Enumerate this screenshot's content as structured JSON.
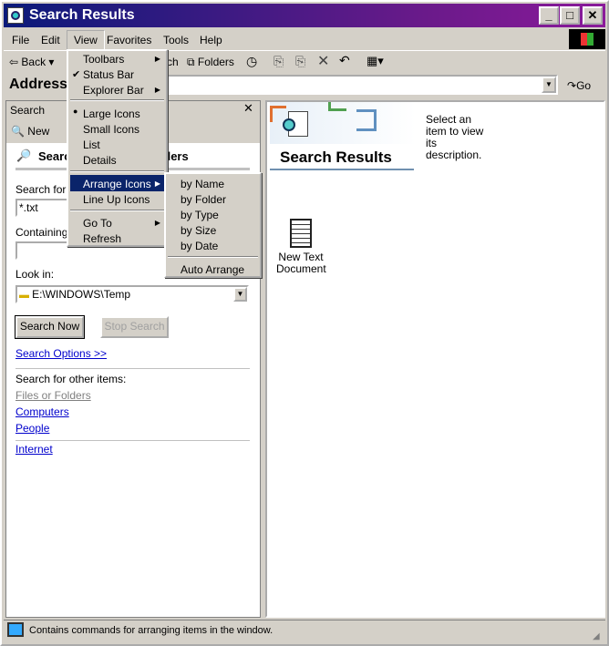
{
  "window": {
    "title": "Search Results"
  },
  "menubar": [
    "File",
    "Edit",
    "View",
    "Favorites",
    "Tools",
    "Help"
  ],
  "toolbar": {
    "back": "Back",
    "search_partial": "ch",
    "folders": "Folders"
  },
  "address": {
    "label": "Address",
    "value": "",
    "go": "Go"
  },
  "search_pane": {
    "header": "Search",
    "new": "New",
    "title": "Search for Files or Folders",
    "named_label": "Search for files or folders named:",
    "named_value": "*.txt",
    "containing_label": "Containing text:",
    "containing_value": "",
    "look_in_label": "Look in:",
    "look_in_value": "E:\\WINDOWS\\Temp",
    "search_now": "Search Now",
    "stop_search": "Stop Search",
    "options": "Search Options >>",
    "other_label": "Search for other items:",
    "other": [
      "Files or Folders",
      "Computers",
      "People"
    ],
    "internet": "Internet"
  },
  "results": {
    "title": "Search Results",
    "hint": "Select an item to view its description.",
    "items": [
      {
        "name": "New Text Document",
        "icon": "text-document-icon"
      }
    ]
  },
  "view_menu": {
    "items": [
      "Toolbars",
      "Status Bar",
      "Explorer Bar",
      "Large Icons",
      "Small Icons",
      "List",
      "Details",
      "Arrange Icons",
      "Line Up Icons",
      "Go To",
      "Refresh"
    ],
    "checked": "Status Bar",
    "selected_radio": "Large Icons",
    "highlighted": "Arrange Icons"
  },
  "arrange_menu": {
    "items": [
      "by Name",
      "by Folder",
      "by Type",
      "by Size",
      "by Date",
      "Auto Arrange"
    ]
  },
  "status": {
    "text": "Contains commands for arranging items in the window."
  },
  "colors": {
    "highlight": "#0a246a",
    "link": "#0000cc"
  }
}
